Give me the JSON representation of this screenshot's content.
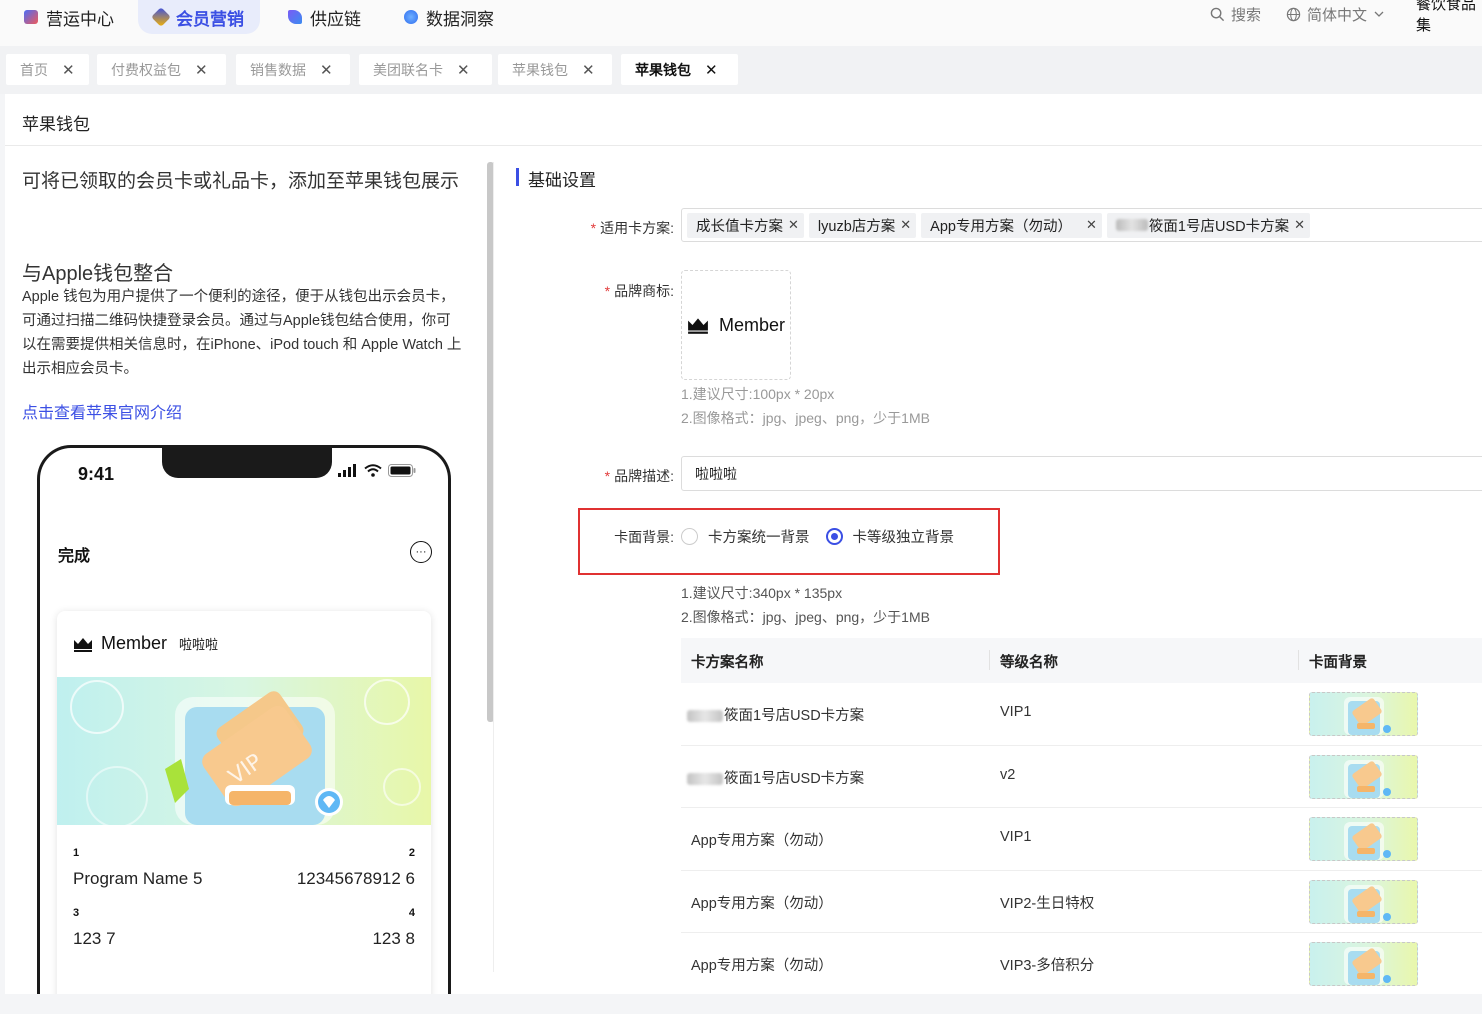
{
  "topnav": {
    "items": [
      {
        "label": "营运中心",
        "color": "#4a6cf7"
      },
      {
        "label": "会员营销",
        "color": "#f5b400"
      },
      {
        "label": "供应链",
        "color": "#5b5bf5"
      },
      {
        "label": "数据洞察",
        "color": "#2f6df0"
      }
    ],
    "search_label": "搜索",
    "language_label": "简体中文",
    "org_label": "餐饮食品集"
  },
  "tabs": [
    {
      "label": "首页"
    },
    {
      "label": "付费权益包"
    },
    {
      "label": "销售数据"
    },
    {
      "label": "美团联名卡"
    },
    {
      "label": "苹果钱包"
    },
    {
      "label": "苹果钱包"
    }
  ],
  "page": {
    "title": "苹果钱包"
  },
  "intro": {
    "lead": "可将已领取的会员卡或礼品卡，添加至苹果钱包展示",
    "heading": "与Apple钱包整合",
    "paragraph": "Apple 钱包为用户提供了一个便利的途径，便于从钱包出示会员卡，可通过扫描二维码快捷登录会员。通过与Apple钱包结合使用，你可以在需要提供相关信息时，在iPhone、iPod touch 和 Apple Watch 上出示相应会员卡。",
    "link": "点击查看苹果官网介绍"
  },
  "phone": {
    "time": "9:41",
    "done_label": "完成",
    "more_label": "···",
    "card": {
      "brand": "Member",
      "description": "啦啦啦",
      "fields": [
        {
          "label": "1",
          "value": "Program Name 5"
        },
        {
          "label": "2",
          "value": "12345678912 6"
        },
        {
          "label": "3",
          "value": "123 7"
        },
        {
          "label": "4",
          "value": "123 8"
        }
      ]
    }
  },
  "form": {
    "section_title": "基础设置",
    "card_plans": {
      "label": "适用卡方案:",
      "chips": [
        "成长值卡方案",
        "lyuzb店方案",
        "App专用方案（勿动）",
        "筱面1号店USD卡方案"
      ]
    },
    "brand_logo": {
      "label": "品牌商标:",
      "preview_text": "Member",
      "hints": [
        "1.建议尺寸:100px * 20px",
        "2.图像格式：jpg、jpeg、png，少于1MB"
      ]
    },
    "brand_desc": {
      "label": "品牌描述:",
      "value": "啦啦啦"
    },
    "card_bg": {
      "label": "卡面背景:",
      "options": [
        {
          "label": "卡方案统一背景",
          "checked": false
        },
        {
          "label": "卡等级独立背景",
          "checked": true
        }
      ],
      "hints": [
        "1.建议尺寸:340px * 135px",
        "2.图像格式：jpg、jpeg、png，少于1MB"
      ]
    }
  },
  "table": {
    "columns": [
      "卡方案名称",
      "等级名称",
      "卡面背景"
    ],
    "rows": [
      {
        "plan": "筱面1号店USD卡方案",
        "level": "VIP1"
      },
      {
        "plan": "筱面1号店USD卡方案",
        "level": "v2"
      },
      {
        "plan": "App专用方案（勿动）",
        "level": "VIP1"
      },
      {
        "plan": "App专用方案（勿动）",
        "level": "VIP2-生日特权"
      },
      {
        "plan": "App专用方案（勿动）",
        "level": "VIP3-多倍积分"
      }
    ]
  },
  "colors": {
    "accent": "#3b4fe4",
    "required": "#e23b3b",
    "highlight_box": "#e03131"
  }
}
